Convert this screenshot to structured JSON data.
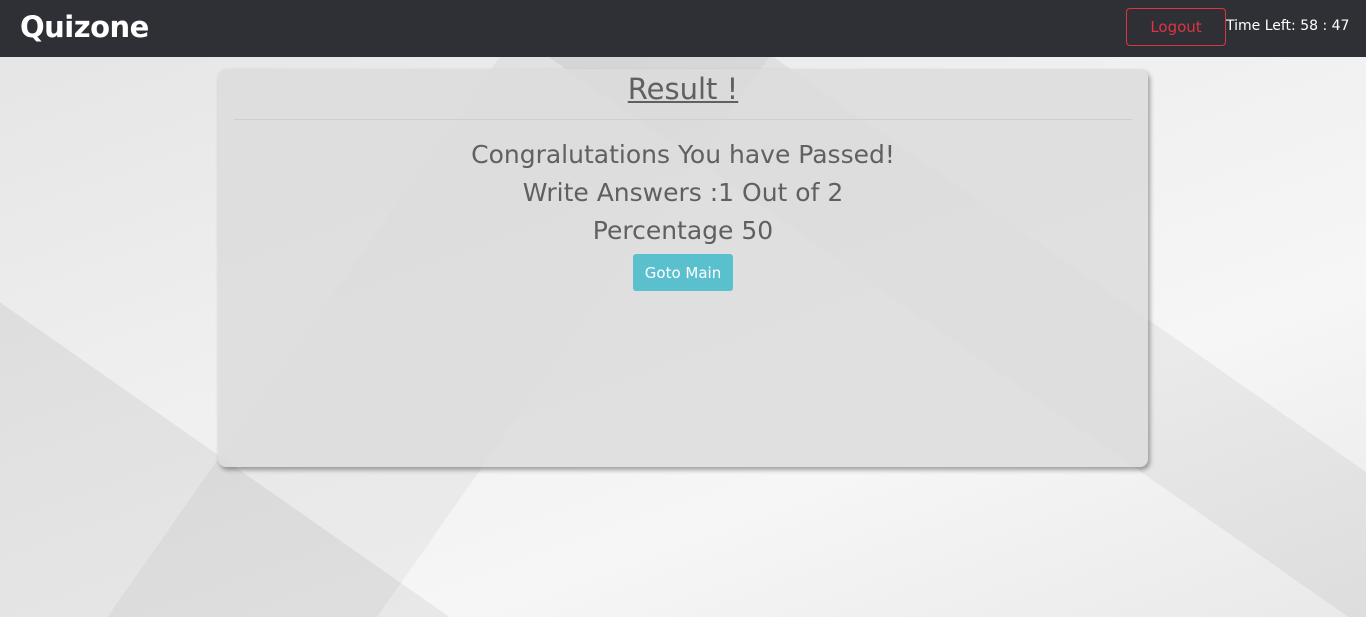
{
  "navbar": {
    "brand": "Quizone",
    "logout_label": "Logout",
    "timer": "Time Left: 58 : 47"
  },
  "result": {
    "title": "Result !",
    "message": "Congralutations You have Passed!",
    "answers": "Write Answers :1 Out of 2",
    "percentage": "Percentage 50",
    "goto_label": "Goto Main"
  },
  "colors": {
    "navbar": "#2f3035",
    "danger": "#dc3545",
    "info": "#5bc0ce"
  }
}
